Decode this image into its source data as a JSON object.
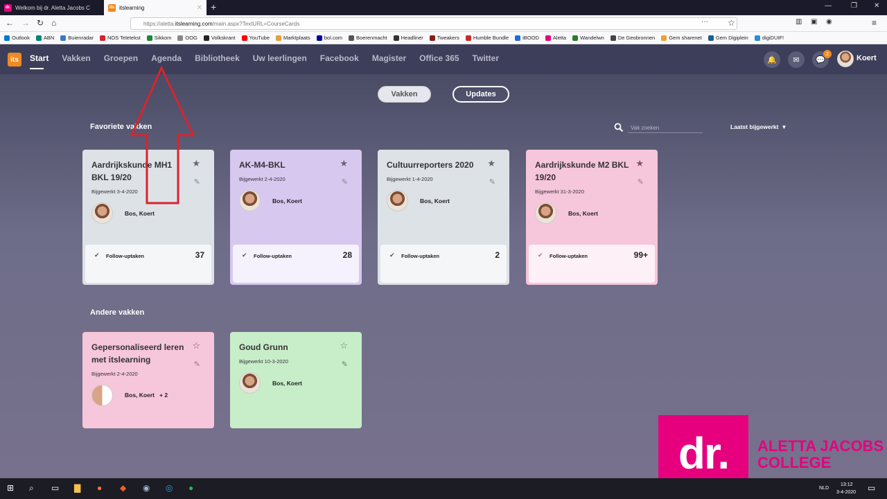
{
  "browser": {
    "tabs": [
      {
        "label": "Welkom bij dr. Aletta Jacobs C",
        "favicon": "dr."
      },
      {
        "label": "itslearning",
        "favicon": "its"
      }
    ],
    "url_prefix": "https://aletta.",
    "url_host": "itslearning.com",
    "url_rest": "/main.aspx?TextURL=CourseCards",
    "bookmarks": [
      {
        "label": "Outlook",
        "color": "#0078d4"
      },
      {
        "label": "ABN",
        "color": "#00857a"
      },
      {
        "label": "Buienradar",
        "color": "#3a78c3"
      },
      {
        "label": "NOS Teletekst",
        "color": "#d9232d"
      },
      {
        "label": "Sikkom",
        "color": "#1a8a3a"
      },
      {
        "label": "OOG",
        "color": "#888888"
      },
      {
        "label": "Volkskrant",
        "color": "#222222"
      },
      {
        "label": "YouTube",
        "color": "#ff0000"
      },
      {
        "label": "Marktplaats",
        "color": "#e3a03c"
      },
      {
        "label": "bol.com",
        "color": "#0000a4"
      },
      {
        "label": "Boerenmacht",
        "color": "#555555"
      },
      {
        "label": "Headliner",
        "color": "#333333"
      },
      {
        "label": "Tweakers",
        "color": "#8a1b1b"
      },
      {
        "label": "Humble Bundle",
        "color": "#cc2929"
      },
      {
        "label": "iBOOD",
        "color": "#1d6fd8"
      },
      {
        "label": "Aletta",
        "color": "#e6007e"
      },
      {
        "label": "Wandelwn",
        "color": "#2c7a2c"
      },
      {
        "label": "De Geobronnen",
        "color": "#444444"
      },
      {
        "label": "Gem sharenet",
        "color": "#f0a030"
      },
      {
        "label": "Gem Digiplein",
        "color": "#1a5f8f"
      },
      {
        "label": "digiDUIF!",
        "color": "#2a8dd4"
      }
    ]
  },
  "nav": {
    "logo": "its",
    "items": [
      "Start",
      "Vakken",
      "Groepen",
      "Agenda",
      "Bibliotheek",
      "Uw leerlingen",
      "Facebook",
      "Magister",
      "Office 365",
      "Twitter"
    ],
    "messages_badge": "2",
    "user": "Koert"
  },
  "toggles": {
    "vakken": "Vakken",
    "updates": "Updates"
  },
  "favorites": {
    "title": "Favoriete vakken",
    "search_placeholder": "Vak zoeken",
    "sort_label": "Laatst bijgewerkt",
    "cards": [
      {
        "title": "Aardrijkskunde MH1 BKL 19/20",
        "date": "Bijgewerkt 3-4-2020",
        "owner": "Bos, Koert",
        "follow": "Follow-uptaken",
        "count": "37"
      },
      {
        "title": "AK-M4-BKL",
        "date": "Bijgewerkt 2-4-2020",
        "owner": "Bos, Koert",
        "follow": "Follow-uptaken",
        "count": "28"
      },
      {
        "title": "Cultuurreporters 2020",
        "date": "Bijgewerkt 1-4-2020",
        "owner": "Bos, Koert",
        "follow": "Follow-uptaken",
        "count": "2"
      },
      {
        "title": "Aardrijkskunde M2 BKL 19/20",
        "date": "Bijgewerkt 31-3-2020",
        "owner": "Bos, Koert",
        "follow": "Follow-uptaken",
        "count": "99+"
      }
    ]
  },
  "others": {
    "title": "Andere vakken",
    "cards": [
      {
        "title": "Gepersonaliseerd leren met itslearning",
        "date": "Bijgewerkt 2-4-2020",
        "owner": "Bos, Koert   + 2"
      },
      {
        "title": "Goud Grunn",
        "date": "Bijgewerkt 10-3-2020",
        "owner": "Bos, Koert"
      }
    ]
  },
  "college": {
    "logo": "dr.",
    "line1": "ALETTA JACOBS",
    "line2": "COLLEGE"
  },
  "taskbar": {
    "lang": "NLD",
    "time": "13:12",
    "date": "3-4-2020"
  }
}
